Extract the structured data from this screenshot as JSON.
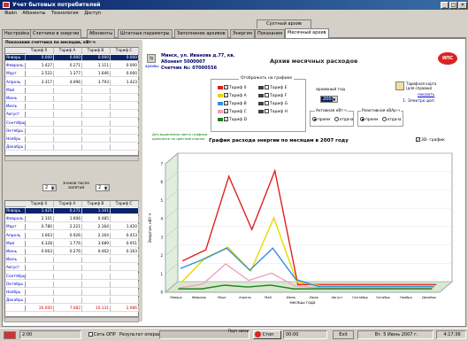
{
  "window": {
    "title": "Учет бытовых потребителей"
  },
  "menu": [
    "Файл",
    "Абоненты",
    "Технология",
    "Доступ"
  ],
  "subtab": "Сухтный архив",
  "tabs": [
    "Настройка",
    "Счетчики в энергии",
    "Абоненты",
    "Штатные параметры",
    "Заполнение архивов",
    "Энергия",
    "Показания",
    "Месячный архив"
  ],
  "left": {
    "title": "Показания счетчика по месяцам, кВт·ч",
    "columns": [
      "Тариф 0",
      "Тариф А",
      "Тариф В",
      "Тариф С"
    ],
    "months": [
      "Январь",
      "Февраль",
      "Март",
      "Апрель",
      "Май",
      "Июнь",
      "Июль",
      "Август",
      "Сентябрь",
      "Октябрь",
      "Ноябрь",
      "Декабрь"
    ],
    "top_rows": [
      [
        "0.000",
        "0.000",
        "0.000",
        "0.000"
      ],
      [
        "1.427",
        "0.271",
        "1.111",
        "0.000"
      ],
      [
        "2.522",
        "1.377",
        "1.646",
        "0.000"
      ],
      [
        "3.317",
        "4.096",
        "3.793",
        "1.423"
      ]
    ],
    "digits_label": "знаков после запятой",
    "digits_left": "2",
    "digits_right": "2",
    "bottom_columns": [
      "Тариф 0",
      "Тариф А",
      "Тариф В",
      "Тариф С"
    ],
    "bottom_rows": [
      [
        "1.421",
        "0.271",
        "1.101",
        ""
      ],
      [
        "2.101",
        "1.606",
        "0.485",
        ""
      ],
      [
        "0.780",
        "2.221",
        "2.164",
        "1.420"
      ],
      [
        "3.063",
        "0.926",
        "2.164",
        "0.453"
      ],
      [
        "6.328",
        "1.776",
        "3.689",
        "0.951"
      ],
      [
        "0.063",
        "0.276",
        "0.462",
        "0.163"
      ]
    ],
    "totals": [
      "20.000",
      "7.082",
      "10.131",
      "2.986"
    ]
  },
  "header": {
    "address": "Минск, ул. Иванова д.77, кв.",
    "subscriber": "Абонент 5000007",
    "meter": "Счетчик №: 07000556",
    "archive_title": "Архив месячных расходов",
    "brand": "ИПС",
    "archive_button": "архивы"
  },
  "legend": {
    "title": "Отображать на графике",
    "items": [
      {
        "label": "Тариф 0",
        "color": "#e02020",
        "checked": true
      },
      {
        "label": "Тариф А",
        "color": "#e8d800",
        "checked": true
      },
      {
        "label": "Тариф В",
        "color": "#3090e0",
        "checked": true
      },
      {
        "label": "Тариф С",
        "color": "#f0a0c0",
        "checked": true
      },
      {
        "label": "Тариф D",
        "color": "#208020",
        "checked": true
      },
      {
        "label": "Тариф Е",
        "color": "#404040",
        "checked": false
      },
      {
        "label": "Тариф F",
        "color": "#404040",
        "checked": false
      },
      {
        "label": "Тариф G",
        "color": "#404040",
        "checked": false
      },
      {
        "label": "Тариф Н",
        "color": "#404040",
        "checked": false
      }
    ]
  },
  "year": {
    "label": "архивный год",
    "value": "2007"
  },
  "tariff_card": {
    "label": "Тарифная карта (для справки)",
    "link": "показать",
    "item": "1. Электро доп."
  },
  "active": {
    "label": "Активная кВт·ч",
    "options": [
      "прием",
      "отдача"
    ],
    "selected": 0
  },
  "reactive": {
    "label": "Реактивная кВАр·ч",
    "options": [
      "прием",
      "отдача"
    ],
    "selected": 0
  },
  "note": "Для выделения цвета графика щелкните по цветной кнопке",
  "chart3d_label": "3D- график",
  "chart_data": {
    "type": "line",
    "title": "График расхода энергии по месяцам в 2007 году",
    "xlabel": "месяцы года",
    "ylabel": "Энергия, кВт·ч",
    "categories": [
      "Январь",
      "Февраль",
      "Март",
      "Апрель",
      "Май",
      "Июнь",
      "Июль",
      "Август",
      "Сентябрь",
      "Октябрь",
      "Ноябрь",
      "Декабрь"
    ],
    "ylim": [
      0,
      7
    ],
    "yticks": [
      0,
      1,
      2,
      3,
      4,
      5,
      6,
      7
    ],
    "series": [
      {
        "name": "Тариф 0",
        "color": "#e02020",
        "values": [
          1.4,
          2.0,
          6.0,
          3.1,
          6.3,
          0.1,
          0.1,
          0.1,
          0.1,
          0.1,
          0.1,
          0.1
        ]
      },
      {
        "name": "Тариф А",
        "color": "#e8d800",
        "values": [
          0.3,
          1.6,
          2.2,
          0.9,
          3.8,
          0.3,
          0.1,
          0.1,
          0.1,
          0.1,
          0.1,
          0.1
        ]
      },
      {
        "name": "Тариф В",
        "color": "#3090e0",
        "values": [
          1.1,
          1.6,
          2.2,
          1.0,
          2.2,
          0.5,
          0.1,
          0.1,
          0.1,
          0.1,
          0.1,
          0.1
        ]
      },
      {
        "name": "Тариф С",
        "color": "#f0a0c0",
        "values": [
          0.1,
          0.3,
          1.4,
          0.5,
          0.9,
          0.2,
          0.1,
          0.1,
          0.1,
          0.1,
          0.1,
          0.1
        ]
      },
      {
        "name": "Тариф D",
        "color": "#208020",
        "values": [
          0.1,
          0.1,
          0.3,
          0.2,
          0.3,
          0.1,
          0.1,
          0.1,
          0.1,
          0.1,
          0.1,
          0.1
        ]
      }
    ]
  },
  "status": {
    "time": "2:00",
    "log_label": "Сеть ОПР",
    "result_label": "Результат операции",
    "port_label": "Порт связи",
    "stop_label": "Стоп",
    "timer": "00:00",
    "exit": "Exit",
    "date": "Вт. 5 Июнь 2007 г.",
    "clock": "4:17:36"
  }
}
